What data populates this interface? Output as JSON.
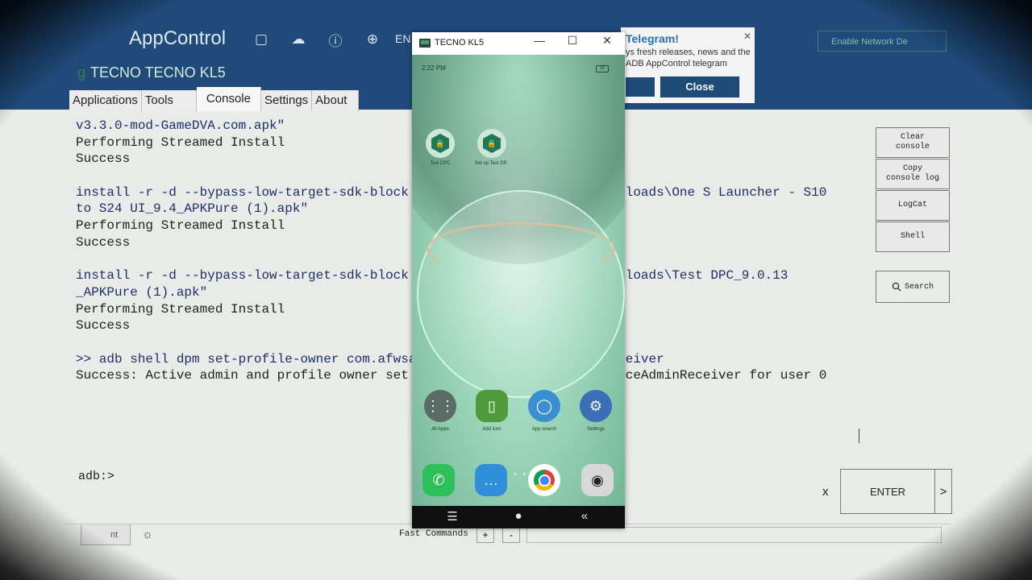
{
  "app": {
    "logo": "AppControl",
    "lang": "EN",
    "device_name": "TECNO TECNO KL5",
    "enable_network": "Enable Network De"
  },
  "tabs": [
    "Applications",
    "Tools",
    "Console",
    "Settings",
    "About"
  ],
  "telegram": {
    "title": "Telegram!",
    "text": "ys fresh releases, news and the ADB AppControl telegram",
    "close": "Close"
  },
  "console": {
    "lines": [
      {
        "text": "v3.3.0-mod-GameDVA.com.apk\"",
        "cmd": true
      },
      {
        "text": "Performing Streamed Install",
        "cmd": false
      },
      {
        "text": "Success",
        "cmd": false
      },
      {
        "text": "",
        "cmd": false
      },
      {
        "text": "install -r -d --bypass-low-target-sdk-block                         ownloads\\One S Launcher - S10",
        "cmd": true
      },
      {
        "text": "to S24 UI_9.4_APKPure (1).apk\"",
        "cmd": true
      },
      {
        "text": "Performing Streamed Install",
        "cmd": false
      },
      {
        "text": "Success",
        "cmd": false
      },
      {
        "text": "",
        "cmd": false
      },
      {
        "text": "install -r -d --bypass-low-target-sdk-block                         ownloads\\Test DPC_9.0.13",
        "cmd": true
      },
      {
        "text": "_APKPure (1).apk\"",
        "cmd": true
      },
      {
        "text": "Performing Streamed Install",
        "cmd": false
      },
      {
        "text": "Success",
        "cmd": false
      },
      {
        "text": "",
        "cmd": false
      },
      {
        "text": ">> adb shell dpm set-profile-owner com.afwsan                        eceiver",
        "cmd": true
      },
      {
        "text": "Success: Active admin and profile owner set t                       eviceAdminReceiver for user 0",
        "cmd": false
      }
    ],
    "prompt": "adb:>"
  },
  "side_buttons": {
    "clear": "Clear\nconsole",
    "copy": "Copy\nconsole log",
    "logcat": "LogCat",
    "shell": "Shell",
    "search": "Search"
  },
  "input": {
    "clear_x": "x",
    "enter": "ENTER",
    "send": ">"
  },
  "bottom": {
    "tab_partial": "nt",
    "fast_commands": "Fast Commands",
    "plus": "+",
    "minus": "-"
  },
  "mirror": {
    "title": "TECNO KL5",
    "time": "2:22 PM",
    "battery": "96",
    "apps_top": [
      {
        "label": "Test DPC",
        "icon": "hex-shield-icon"
      },
      {
        "label": "Set up Test DP..",
        "icon": "hex-shield-icon"
      }
    ],
    "row_apps": [
      {
        "label": "All Apps",
        "icon": "grid-icon",
        "color": "#5d6b66"
      },
      {
        "label": "Add icon",
        "icon": "add-widget-icon",
        "color": "#4f9a3b"
      },
      {
        "label": "App search",
        "icon": "search-icon",
        "color": "#3a8fd0"
      },
      {
        "label": "Settings",
        "icon": "gear-icon",
        "color": "#3a6fb8"
      }
    ],
    "dock_apps": [
      {
        "icon": "phone-icon",
        "color": "#2fbf5a"
      },
      {
        "icon": "message-icon",
        "color": "#2f8fd8"
      },
      {
        "icon": "chrome-icon",
        "color": "#ffffff"
      },
      {
        "icon": "camera-icon",
        "color": "#d8d8d8"
      }
    ]
  }
}
